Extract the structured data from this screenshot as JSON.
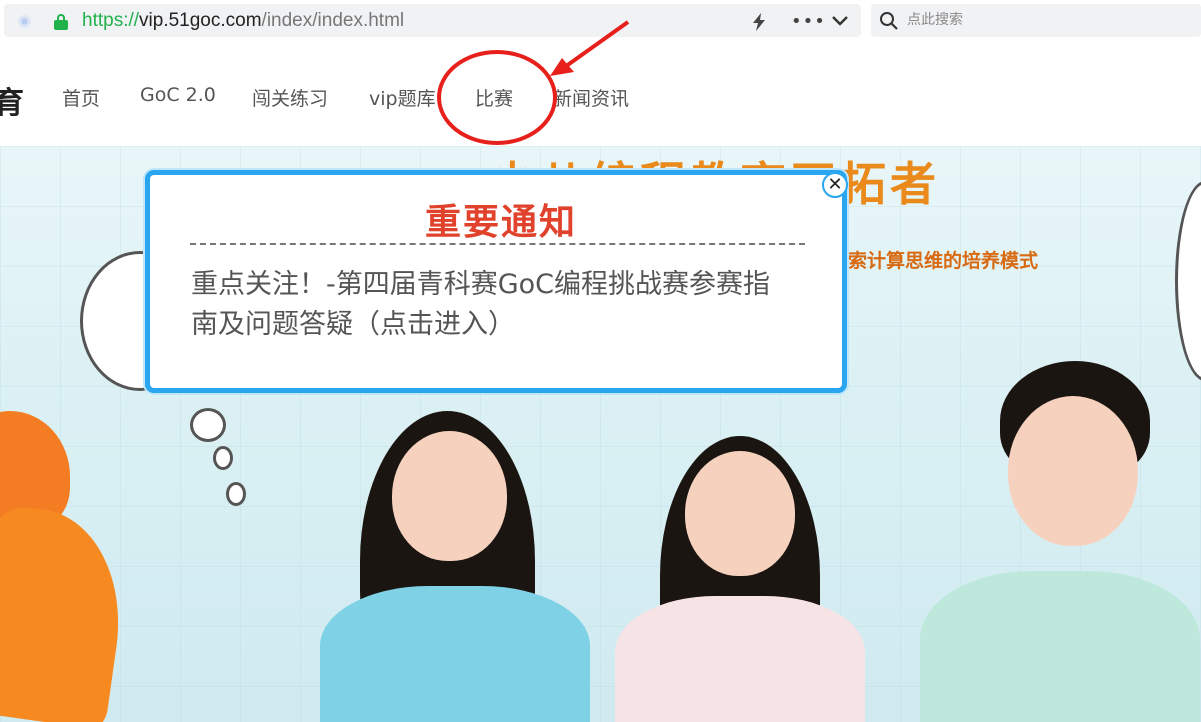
{
  "browser": {
    "url_protocol": "https://",
    "url_host": "vip.51goc.com",
    "url_path": "/index/index.html",
    "more_glyph": "•••",
    "search_placeholder": "点此搜索"
  },
  "nav": {
    "logo_fragment": "育",
    "items": [
      {
        "label": "首页"
      },
      {
        "label": "GoC 2.0"
      },
      {
        "label": "闯关练习"
      },
      {
        "label": "vip题库"
      },
      {
        "label": "比赛"
      },
      {
        "label": "新闻资讯"
      }
    ]
  },
  "hero": {
    "title": "少儿编程教育开拓者",
    "subtitle": "索计算思维的培养模式"
  },
  "modal": {
    "title": "重要通知",
    "link_text": "重点关注！-第四届青科赛GoC编程挑战赛参赛指南及问题答疑（点击进入）",
    "close_glyph": "✕"
  },
  "colors": {
    "accent": "#2aa6f0",
    "title_red": "#e0422c",
    "annotation_red": "#e8201b",
    "secure_green": "#22b24c",
    "hero_orange": "#e98a1a"
  }
}
